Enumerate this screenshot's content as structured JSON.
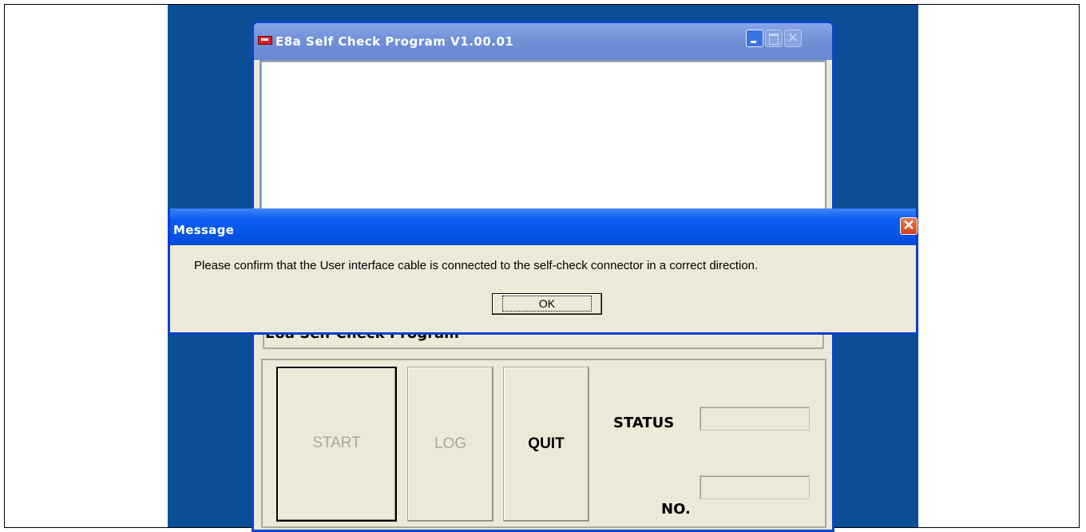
{
  "main_window": {
    "title": "E8a Self Check Program V1.00.01",
    "minimize_icon": "minimize-icon",
    "maximize_icon": "maximize-icon",
    "close_icon": "close-icon",
    "log_text": "",
    "group_caption": "E8a Self Check Program",
    "buttons": {
      "start": "START",
      "log": "LOG",
      "quit": "QUIT"
    },
    "status_label": "STATUS",
    "status_value": "",
    "no_label": "NO.",
    "no_value": ""
  },
  "dialog": {
    "title": "Message",
    "close_icon": "close-icon",
    "message": "Please confirm that the User interface cable is connected to the self-check connector in a correct direction.",
    "ok_label": "OK"
  },
  "colors": {
    "desktop": "#0a4e95",
    "dialog_title": "#0654e6",
    "window_face": "#ece9d8"
  }
}
